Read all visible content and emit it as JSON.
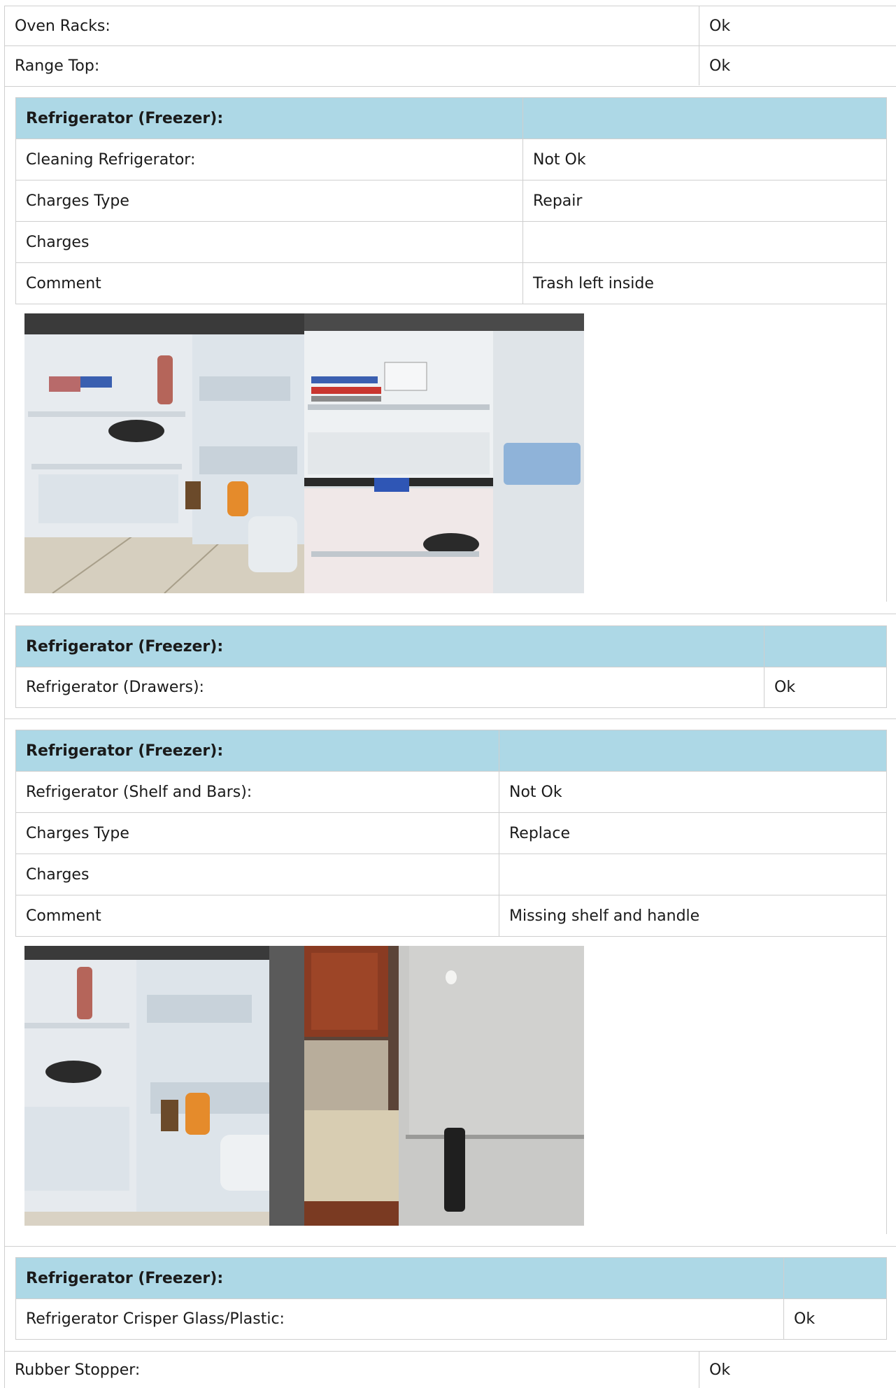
{
  "rows": {
    "oven_racks": {
      "label": "Oven Racks:",
      "value": "Ok"
    },
    "range_top": {
      "label": "Range Top:",
      "value": "Ok"
    },
    "rubber_stopper": {
      "label": "Rubber Stopper:",
      "value": "Ok"
    }
  },
  "sections": [
    {
      "header": "Refrigerator (Freezer):",
      "item_label": "Cleaning Refrigerator:",
      "item_value": "Not Ok",
      "charges_type_label": "Charges Type",
      "charges_type_value": "Repair",
      "charges_label": "Charges",
      "charges_value": "",
      "comment_label": "Comment",
      "comment_value": "Trash left inside",
      "photos": [
        "open-fridge-with-food",
        "fridge-interior-trays"
      ]
    },
    {
      "header": "Refrigerator (Freezer):",
      "item_label": "Refrigerator (Drawers):",
      "item_value": "Ok"
    },
    {
      "header": "Refrigerator (Freezer):",
      "item_label": "Refrigerator (Shelf and Bars):",
      "item_value": "Not Ok",
      "charges_type_label": "Charges Type",
      "charges_type_value": "Replace",
      "charges_label": "Charges",
      "charges_value": "",
      "comment_label": "Comment",
      "comment_value": "Missing shelf and handle",
      "photos": [
        "open-fridge-door-shelves",
        "fridge-door-missing-handle"
      ]
    },
    {
      "header": "Refrigerator (Freezer):",
      "item_label": "Refrigerator Crisper Glass/Plastic:",
      "item_value": "Ok"
    }
  ],
  "colors": {
    "header_bg": "#add8e6",
    "border": "#cfcfcf"
  }
}
